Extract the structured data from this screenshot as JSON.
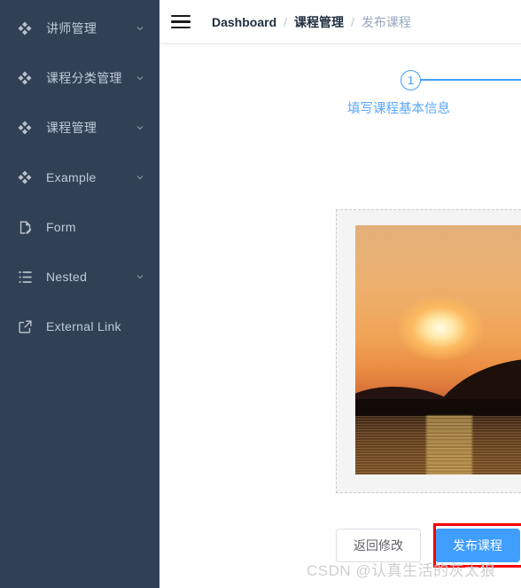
{
  "sidebar": {
    "background_color": "#304156",
    "items": [
      {
        "label": "讲师管理",
        "icon": "component-icon",
        "has_children": true
      },
      {
        "label": "课程分类管理",
        "icon": "component-icon",
        "has_children": true
      },
      {
        "label": "课程管理",
        "icon": "component-icon",
        "has_children": true
      },
      {
        "label": "Example",
        "icon": "component-icon",
        "has_children": true
      },
      {
        "label": "Form",
        "icon": "form-icon",
        "has_children": false
      },
      {
        "label": "Nested",
        "icon": "nested-list-icon",
        "has_children": true
      },
      {
        "label": "External Link",
        "icon": "external-link-icon",
        "has_children": false
      }
    ]
  },
  "navbar": {
    "hamburger_icon": "hamburger-icon",
    "breadcrumb": [
      {
        "label": "Dashboard",
        "current": false
      },
      {
        "label": "课程管理",
        "current": false
      },
      {
        "label": "发布课程",
        "current": true
      }
    ],
    "separator": "/"
  },
  "steps": {
    "active_color": "#409eff",
    "items": [
      {
        "number": "1",
        "title": "填写课程基本信息",
        "active": true
      }
    ]
  },
  "content_card": {
    "image_alt": "sunset-over-water-photo",
    "border_style": "dashed",
    "border_color": "#c9c9c9",
    "background_color": "#f4f4f4"
  },
  "footer": {
    "back_button_label": "返回修改",
    "publish_button_label": "发布课程",
    "publish_button_color": "#409eff",
    "highlight_color": "#f40000"
  },
  "watermark": {
    "text": "CSDN @认真生活的灰太狼"
  }
}
